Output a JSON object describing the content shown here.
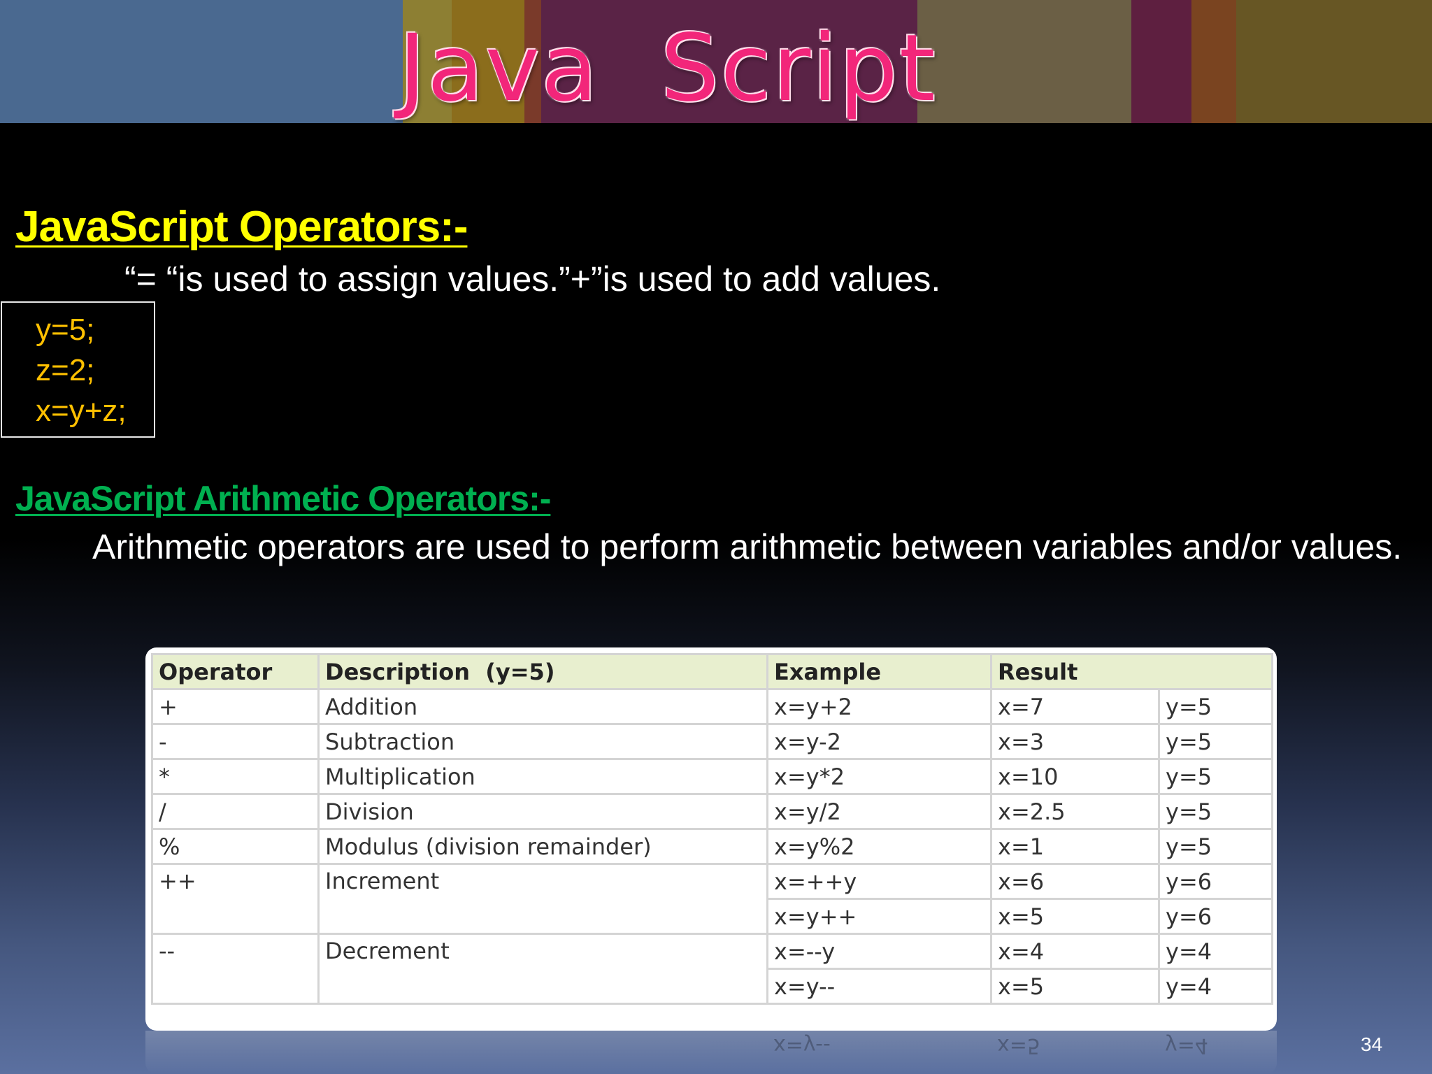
{
  "banner": {
    "title": "Java  Script",
    "stripe_colors": [
      "#4d6a93",
      "#8a7a2e",
      "#8a6a1f",
      "#5a2448",
      "#5c2a4a",
      "#6b5e44",
      "#7a6a3a",
      "#5e1f3f",
      "#7a4a23",
      "#6a5a25"
    ]
  },
  "section1": {
    "heading": "JavaScript Operators:-",
    "text": "“= “is used to assign values.”+”is used to add values.",
    "code_lines": [
      "y=5;",
      "z=2;",
      "x=y+z;"
    ]
  },
  "section2": {
    "heading": "JavaScript Arithmetic Operators:-",
    "text": "Arithmetic operators are used to perform arithmetic between variables and/or values."
  },
  "table": {
    "headers": {
      "operator": "Operator",
      "description": "Description",
      "description_note": "(y=5)",
      "example": "Example",
      "result": "Result"
    },
    "rows": {
      "add": {
        "op": "+",
        "desc": "Addition",
        "example": "x=y+2",
        "x": "x=7",
        "y": "y=5"
      },
      "sub": {
        "op": "-",
        "desc": "Subtraction",
        "example": "x=y-2",
        "x": "x=3",
        "y": "y=5"
      },
      "mul": {
        "op": "*",
        "desc": "Multiplication",
        "example": "x=y*2",
        "x": "x=10",
        "y": "y=5"
      },
      "div": {
        "op": "/",
        "desc": "Division",
        "example": "x=y/2",
        "x": "x=2.5",
        "y": "y=5"
      },
      "mod": {
        "op": "%",
        "desc": "Modulus (division remainder)",
        "example": "x=y%2",
        "x": "x=1",
        "y": "y=5"
      },
      "inc_pre": {
        "op": "++",
        "desc": "Increment",
        "example": "x=++y",
        "x": "x=6",
        "y": "y=6"
      },
      "inc_post": {
        "example": "x=y++",
        "x": "x=5",
        "y": "y=6"
      },
      "dec_pre": {
        "op": "--",
        "desc": "Decrement",
        "example": "x=--y",
        "x": "x=4",
        "y": "y=4"
      },
      "dec_post": {
        "example": "x=y--",
        "x": "x=5",
        "y": "y=4"
      }
    },
    "header_bg": "#e8efcf",
    "border_color": "#d4d4d4"
  },
  "page_number": "34"
}
